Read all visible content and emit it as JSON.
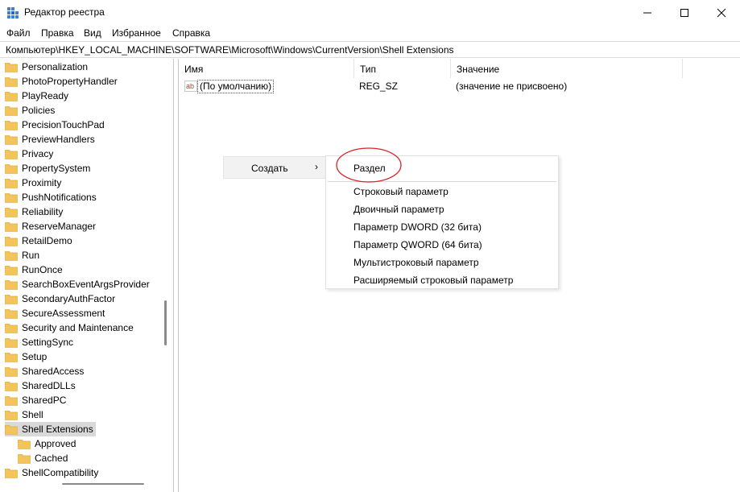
{
  "window": {
    "title": "Редактор реестра",
    "controls": {
      "minimize": "—",
      "maximize": "☐",
      "close": "✕"
    }
  },
  "menu": [
    "Файл",
    "Правка",
    "Вид",
    "Избранное",
    "Справка"
  ],
  "address_path": "Компьютер\\HKEY_LOCAL_MACHINE\\SOFTWARE\\Microsoft\\Windows\\CurrentVersion\\Shell Extensions",
  "tree": {
    "items": [
      "Personalization",
      "PhotoPropertyHandler",
      "PlayReady",
      "Policies",
      "PrecisionTouchPad",
      "PreviewHandlers",
      "Privacy",
      "PropertySystem",
      "Proximity",
      "PushNotifications",
      "Reliability",
      "ReserveManager",
      "RetailDemo",
      "Run",
      "RunOnce",
      "SearchBoxEventArgsProvider",
      "SecondaryAuthFactor",
      "SecureAssessment",
      "Security and Maintenance",
      "SettingSync",
      "Setup",
      "SharedAccess",
      "SharedDLLs",
      "SharedPC",
      "Shell",
      "Shell Extensions"
    ],
    "selected": "Shell Extensions",
    "children": [
      "Approved",
      "Cached"
    ],
    "after": [
      "ShellCompatibility"
    ]
  },
  "list": {
    "headers": {
      "name": "Имя",
      "type": "Тип",
      "value": "Значение"
    },
    "rows": [
      {
        "icon": "ab",
        "name": "(По умолчанию)",
        "type": "REG_SZ",
        "value": "(значение не присвоено)"
      }
    ]
  },
  "context_menu": {
    "create_label": "Создать",
    "arrow": "›",
    "submenu": [
      "Раздел",
      "Строковый параметр",
      "Двоичный параметр",
      "Параметр DWORD (32 бита)",
      "Параметр QWORD (64 бита)",
      "Мультистроковый параметр",
      "Расширяемый строковый параметр"
    ]
  },
  "colors": {
    "folder": "#F2C55C",
    "folder_dark": "#E2A93A",
    "selection": "#d9d9d9",
    "highlight_circle": "#d8232a"
  }
}
